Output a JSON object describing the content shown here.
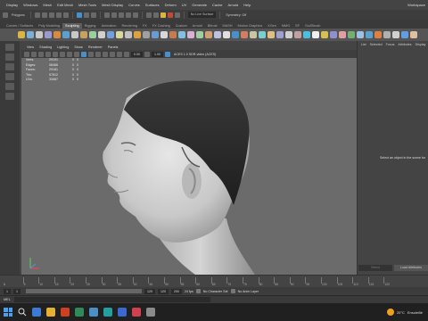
{
  "menubar": {
    "items": [
      "Display",
      "Windows",
      "Mesh",
      "Edit Mesh",
      "Mesh Tools",
      "Mesh Display",
      "Curves",
      "Surfaces",
      "Deform",
      "UV",
      "Generate",
      "Cache",
      "Arnold",
      "Help"
    ],
    "window_controls": "Workspace"
  },
  "statusline": {
    "selection_mode": "Polygons",
    "live_surface": "No Live Surface",
    "symmetry": "Symmetry: Off"
  },
  "shelf_tabs": {
    "items": [
      "Curves / Surfaces",
      "Poly Modeling",
      "Sculpting",
      "Rigging",
      "Animation",
      "Rendering",
      "FX",
      "FX Caching",
      "Custom",
      "Arnold",
      "Bifrost",
      "MASH",
      "Motion Graphics",
      "XGen",
      "MMG",
      "SF",
      "GoZBrush"
    ],
    "active_index": 2
  },
  "panel_menu": [
    "View",
    "Shading",
    "Lighting",
    "Show",
    "Renderer",
    "Panels"
  ],
  "panel_tools": {
    "exposure": "0.00",
    "gamma": "1.00",
    "colorspace": "ACES 1.0 SDR-video (ACES)"
  },
  "hud": {
    "rows": [
      {
        "label": "Verts:",
        "a": "29191",
        "b": "0",
        "c": "0"
      },
      {
        "label": "Edges:",
        "a": "58466",
        "b": "0",
        "c": "0"
      },
      {
        "label": "Faces:",
        "a": "29181",
        "b": "0",
        "c": "0"
      },
      {
        "label": "Tris:",
        "a": "57812",
        "b": "0",
        "c": "0"
      },
      {
        "label": "UVs:",
        "a": "30687",
        "b": "0",
        "c": "0"
      }
    ]
  },
  "right_panel": {
    "tabs": [
      "List",
      "Selected",
      "Focus",
      "Attributes",
      "Display"
    ],
    "message": "Select an object in the scene for",
    "bottom_buttons": [
      "Select",
      "Load Attributes"
    ]
  },
  "timeline": {
    "ticks": [
      "5",
      "10",
      "15",
      "20",
      "25",
      "30",
      "35",
      "40",
      "45",
      "50",
      "55",
      "60",
      "65",
      "70",
      "75",
      "80",
      "85",
      "90",
      "95",
      "100",
      "105",
      "110",
      "115",
      "120"
    ],
    "current": "1"
  },
  "range": {
    "start": "1",
    "inner_start": "1",
    "inner_end": "120",
    "end": "120",
    "anim_end": "200",
    "anim_end2": "200",
    "fps": "24 fps",
    "character_set": "No Character Set",
    "anim_layer": "No Anim Layer"
  },
  "command_line": {
    "label": "MEL"
  },
  "taskbar": {
    "temperature": "20°C",
    "weather_text": "Ensoleillé",
    "app_colors": [
      "#3a7bd5",
      "#e8b030",
      "#d04020",
      "#2e8b57",
      "#4a90c8",
      "#22a0a0",
      "#3a6ad0",
      "#d04050",
      "#8a8a8a"
    ]
  },
  "colors": {
    "viewport_bg": "#6b6b6b",
    "accent_blue": "#4a90c8"
  }
}
